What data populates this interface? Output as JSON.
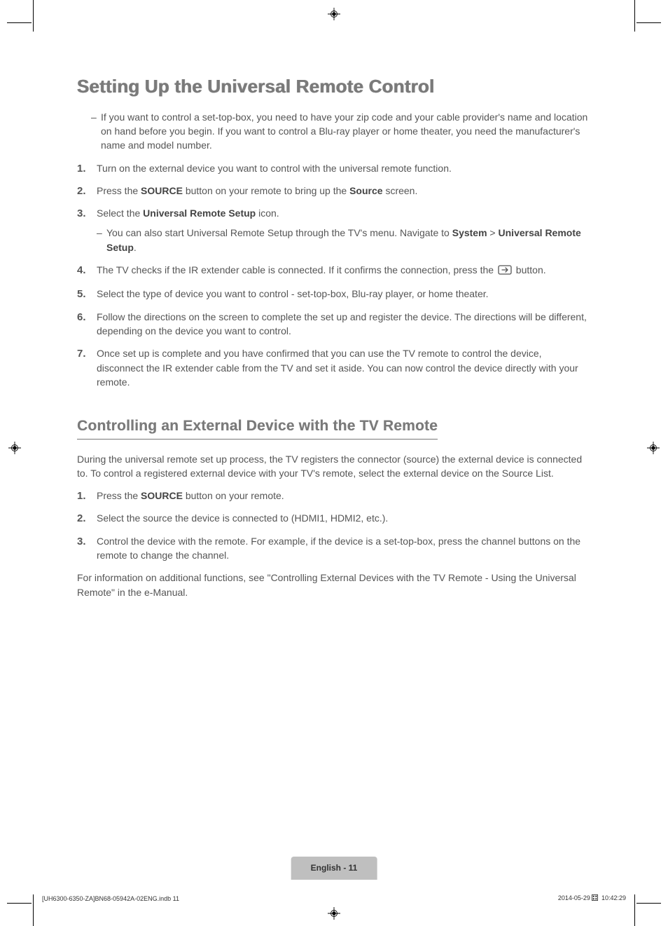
{
  "heading1": "Setting Up the Universal Remote Control",
  "intro_dash": "If you want to control a set-top-box, you need to have your zip code and your cable provider's name and location on hand before you begin. If you want to control a Blu-ray player or home theater, you need the manufacturer's name and model number.",
  "steps1": {
    "s1": "Turn on the external device you want to control with the universal remote function.",
    "s2_a": "Press the ",
    "s2_b": "SOURCE",
    "s2_c": " button on your remote to bring up the ",
    "s2_d": "Source",
    "s2_e": " screen.",
    "s3_a": "Select the ",
    "s3_b": "Universal Remote Setup",
    "s3_c": " icon.",
    "s3_sub_a": "You can also start Universal Remote Setup through the TV's menu. Navigate to ",
    "s3_sub_b": "System",
    "s3_sub_c": " > ",
    "s3_sub_d": "Universal Remote Setup",
    "s3_sub_e": ".",
    "s4_a": "The TV checks if the IR extender cable is connected. If it confirms the connection, press the ",
    "s4_b": " button.",
    "s5": "Select the type of device you want to control - set-top-box, Blu-ray player, or home theater.",
    "s6": "Follow the directions on the screen to complete the set up and register the device. The directions will be different, depending on the device you want to control.",
    "s7": "Once set up is complete and you have confirmed that you can use the TV remote to control the device, disconnect the IR  extender cable from the TV and set it aside. You can now control the device directly with your remote."
  },
  "heading2": "Controlling an External Device with the TV Remote",
  "para2": "During the universal remote set up process, the TV registers the connector (source) the external device is connected to. To control a registered external device with your TV's remote, select the external device on the Source List.",
  "steps2": {
    "s1_a": "Press the ",
    "s1_b": "SOURCE",
    "s1_c": " button on your remote.",
    "s2": "Select the source the device is connected to (HDMI1, HDMI2, etc.).",
    "s3": "Control the device with the remote. For example, if the device is a set-top-box, press the channel buttons on the remote  to change the channel."
  },
  "para_end": "For information on additional functions, see \"Controlling External Devices with the TV Remote - Using the Universal Remote\" in the e-Manual.",
  "footer_tab": "English - 11",
  "footer_left": "[UH6300-6350-ZA]BN68-05942A-02ENG.indb   11",
  "footer_right": "2014-05-29   ",
  "footer_time": "10:42:29"
}
